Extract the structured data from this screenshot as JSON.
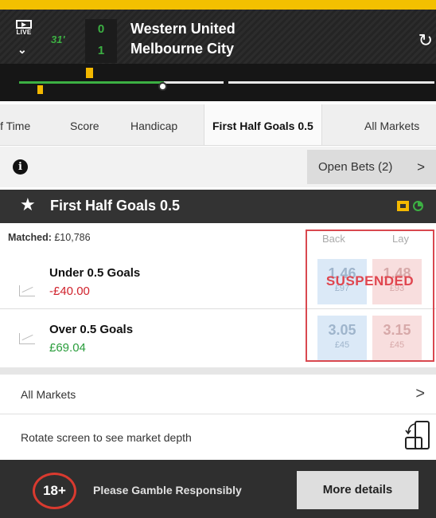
{
  "header": {
    "live_label": "LIVE",
    "minute": "31'",
    "home_score": "0",
    "away_score": "1",
    "home_team": "Western United",
    "away_team": "Melbourne City",
    "colors": {
      "accent": "#f3c000",
      "live_green": "#3cb043"
    },
    "icons": [
      "live-tv-icon",
      "chevron-down-icon",
      "refresh-icon"
    ]
  },
  "tabs": [
    "lf Time",
    "Score",
    "Handicap",
    "First Half Goals 0.5",
    "All Markets"
  ],
  "active_tab": "First Half Goals 0.5",
  "toolbar": {
    "info_icon": "info-icon",
    "open_bets_label": "Open Bets (2)",
    "open_bets_arrow": ">"
  },
  "market": {
    "title": "First Half Goals 0.5",
    "matched_label": "Matched:",
    "matched_value": "£10,786",
    "back_label": "Back",
    "lay_label": "Lay",
    "status": "SUSPENDED",
    "selections": [
      {
        "name": "Under 0.5 Goals",
        "pl": "-£40.00",
        "back_price": "1.46",
        "back_size": "£97",
        "lay_price": "1.48",
        "lay_size": "£93"
      },
      {
        "name": "Over 0.5 Goals",
        "pl": "£69.04",
        "back_price": "3.05",
        "back_size": "£45",
        "lay_price": "3.15",
        "lay_size": "£45"
      }
    ]
  },
  "links": {
    "all_markets": "All Markets",
    "all_markets_arrow": ">",
    "rotate": "Rotate screen to see market depth"
  },
  "footer": {
    "age_badge": "18+",
    "message": "Please Gamble Responsibly",
    "more_details": "More details"
  }
}
